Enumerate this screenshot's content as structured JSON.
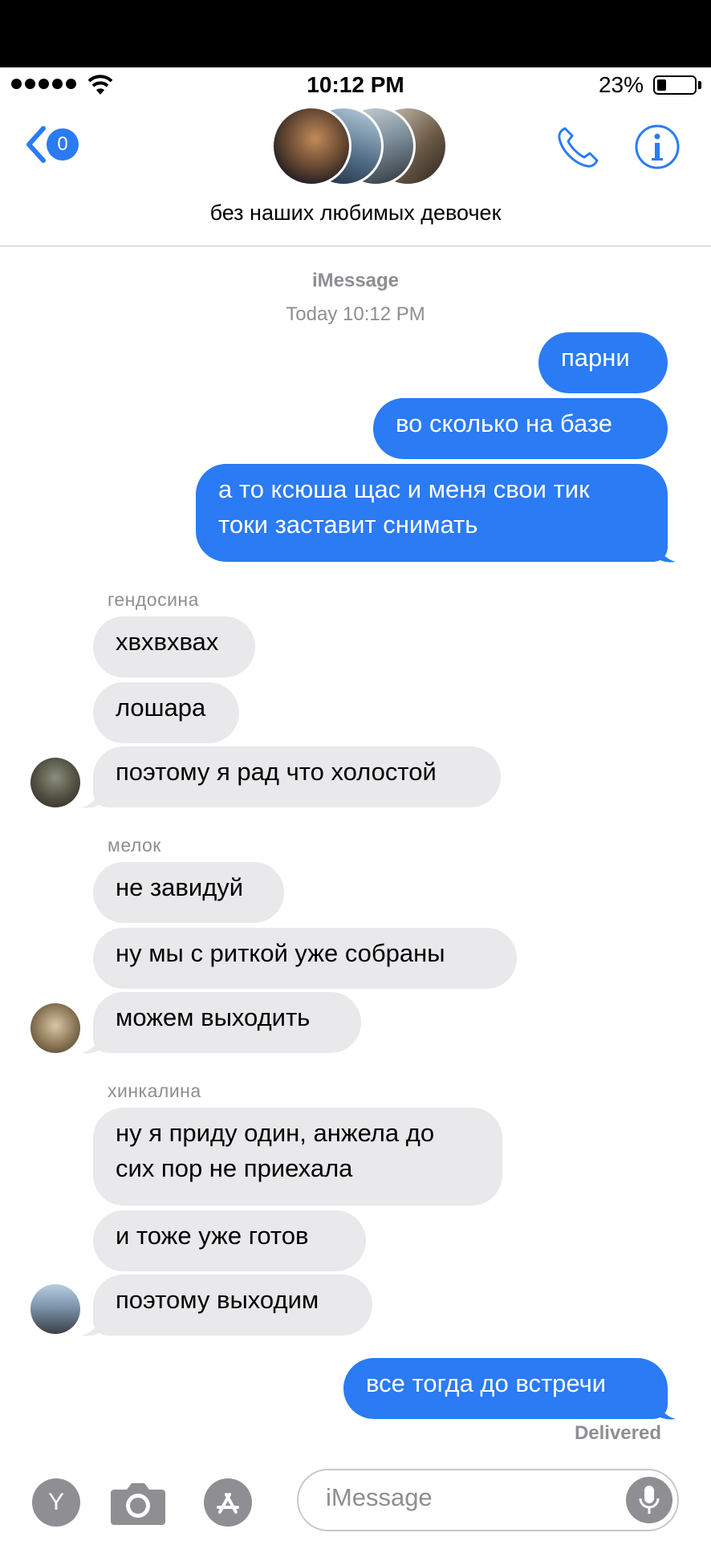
{
  "status_bar": {
    "time": "10:12 PM",
    "battery": "23%",
    "battery_level": 0.23
  },
  "header": {
    "unread_count": "0",
    "group_name": "без наших любимых девочек"
  },
  "thread": {
    "service": "iMessage",
    "timestamp": "Today 10:12 PM"
  },
  "messages_out_1": [
    "парни",
    "во сколько на базе",
    "а то ксюша щас и меня свои тик",
    "токи заставит снимать"
  ],
  "groups": [
    {
      "sender": "гендосина",
      "messages": [
        "хвхвхвах",
        "лошара",
        "поэтому я рад что холостой"
      ]
    },
    {
      "sender": "мелок",
      "messages": [
        "не завидуй",
        "ну мы с риткой уже собраны",
        "можем выходить"
      ]
    },
    {
      "sender": "хинкалина",
      "messages": [
        "ну я приду один, анжела до",
        "сих пор не приехала",
        "и тоже уже готов",
        "поэтому выходим"
      ]
    }
  ],
  "messages_out_2": [
    "все тогда до встречи"
  ],
  "delivered": "Delivered",
  "composer": {
    "placeholder": "iMessage",
    "y_label": "Y"
  },
  "colors": {
    "accent": "#2a7bf4",
    "incoming": "#e9e9eb",
    "meta": "#8e8e93"
  }
}
